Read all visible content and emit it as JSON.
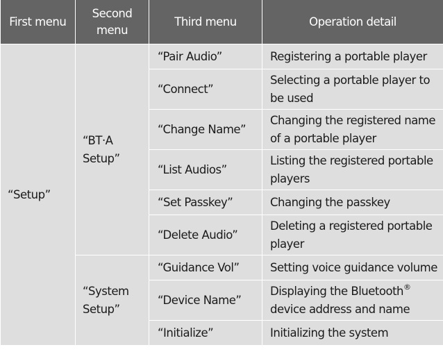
{
  "table": {
    "headers": [
      "First menu",
      "Second menu",
      "Third menu",
      "Operation detail"
    ],
    "first_menu": "“Setup”",
    "groups": [
      {
        "second_menu": "“BT·A Setup”",
        "rows": [
          {
            "third": "“Pair Audio”",
            "detail": "Registering a portable player"
          },
          {
            "third": "“Connect”",
            "detail": "Selecting a portable player to be used"
          },
          {
            "third": "“Change Name”",
            "detail": "Changing the registered name of a portable player"
          },
          {
            "third": "“List Audios”",
            "detail": "Listing the registered portable players"
          },
          {
            "third": "“Set Passkey”",
            "detail": "Changing the passkey"
          },
          {
            "third": "“Delete Audio”",
            "detail": "Deleting a registered portable player"
          }
        ]
      },
      {
        "second_menu": "“System Setup”",
        "rows": [
          {
            "third": "“Guidance Vol”",
            "detail": "Setting voice guidance volume"
          },
          {
            "third": "“Device Name”",
            "detail": "Displaying the Bluetooth",
            "detail_sup": "®",
            "detail_tail": " device address and name"
          },
          {
            "third": "“Initialize”",
            "detail": "Initializing the system"
          }
        ]
      }
    ]
  },
  "colors": {
    "header_bg": "#646464",
    "cell_bg": "#dedede",
    "border": "#ffffff"
  }
}
